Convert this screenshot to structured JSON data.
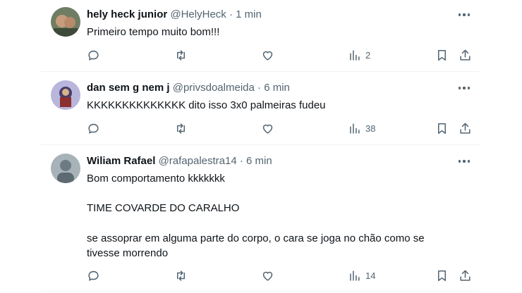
{
  "tweets": [
    {
      "name": "hely heck junior",
      "handle": "@HelyHeck",
      "separator": "·",
      "time": "1 min",
      "text": "Primeiro tempo muito bom!!!",
      "views": "2",
      "avatar_colors": [
        "#7a8a6a",
        "#c9a27e"
      ]
    },
    {
      "name": "dan sem g nem j",
      "handle": "@privsdoalmeida",
      "separator": "·",
      "time": "6 min",
      "text": "KKKKKKKKKKKKKK dito isso 3x0 palmeiras fudeu",
      "views": "38",
      "avatar_colors": [
        "#b7b4d9",
        "#7a2a2a"
      ]
    },
    {
      "name": "Wiliam Rafael",
      "handle": "@rafapalestra14",
      "separator": "·",
      "time": "6 min",
      "text": "Bom comportamento kkkkkkk\n\nTIME COVARDE DO CARALHO\n\nse assoprar em alguma parte do corpo, o cara se joga no chão como se tivesse morrendo",
      "views": "14",
      "avatar_colors": [
        "#9aa6ad",
        "#6e7b82"
      ]
    }
  ]
}
